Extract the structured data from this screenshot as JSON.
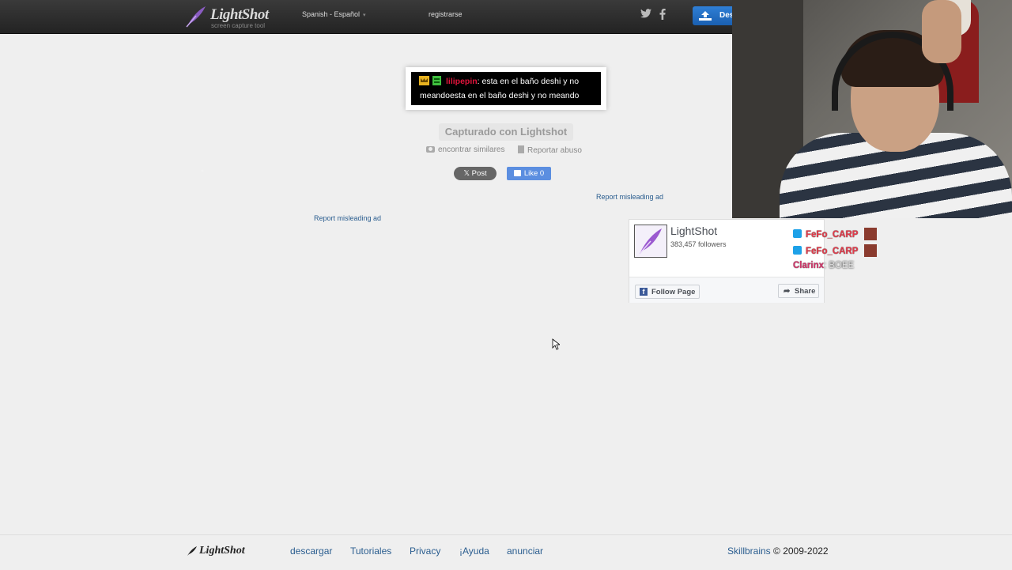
{
  "header": {
    "logo_text": "LightShot",
    "logo_sub": "screen capture tool",
    "language": "Spanish - Español",
    "register": "registrarse",
    "download_label": "Des",
    "icons": [
      "twitter-icon",
      "facebook-icon",
      "download-icon"
    ]
  },
  "screenshot": {
    "chat_user": "lilipepin",
    "line1_msg": ": esta en el baño deshi y no",
    "line2": "meandoesta en el baño deshi y no meando"
  },
  "captured_label": "Capturado con Lightshot",
  "actions": {
    "similar": "encontrar similares",
    "abuse": "Reportar abuso"
  },
  "social": {
    "post": "Post",
    "like": "Like",
    "like_count": "0"
  },
  "ads": {
    "report_1": "Report misleading ad",
    "report_2": "Report misleading ad"
  },
  "fb_widget": {
    "name": "LightShot",
    "followers": "383,457 followers",
    "follow": "Follow Page",
    "share": "Share"
  },
  "stream_chat": [
    {
      "user": "FeFo_CARP",
      "msg": ""
    },
    {
      "user": "FeFo_CARP",
      "msg": ""
    },
    {
      "user": "Clarinx",
      "msg": ": BOEE"
    }
  ],
  "footer": {
    "logo_text": "LightShot",
    "links": [
      "descargar",
      "Tutoriales",
      "Privacy",
      "¡Ayuda",
      "anunciar"
    ],
    "company": "Skillbrains",
    "copyright": " © 2009-2022"
  },
  "colors": {
    "topbar": "#2b2b2b",
    "link": "#2a5d8f",
    "chat_user": "#e0143b",
    "like_button": "#5b8ee0",
    "download_button": "#1a5fb0"
  }
}
